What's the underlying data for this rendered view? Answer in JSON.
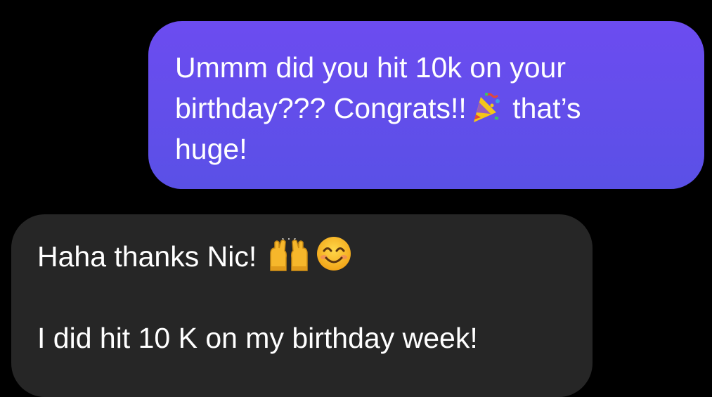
{
  "thread": {
    "sent_message": {
      "line1": "Ummm did you hit 10k on your",
      "line2_before": "birthday??? Congrats!!",
      "line2_emoji": "party-popper-icon",
      "line2_after": "that’s",
      "line3": "huge!",
      "bubble_color": "#6550ec"
    },
    "received_message": {
      "line1_text": "Haha thanks Nic!",
      "line1_emojis": [
        "raising-hands-icon",
        "smiling-face-icon"
      ],
      "line2_text": "I did hit 10 K on my birthday week!",
      "bubble_color": "#262626"
    }
  }
}
